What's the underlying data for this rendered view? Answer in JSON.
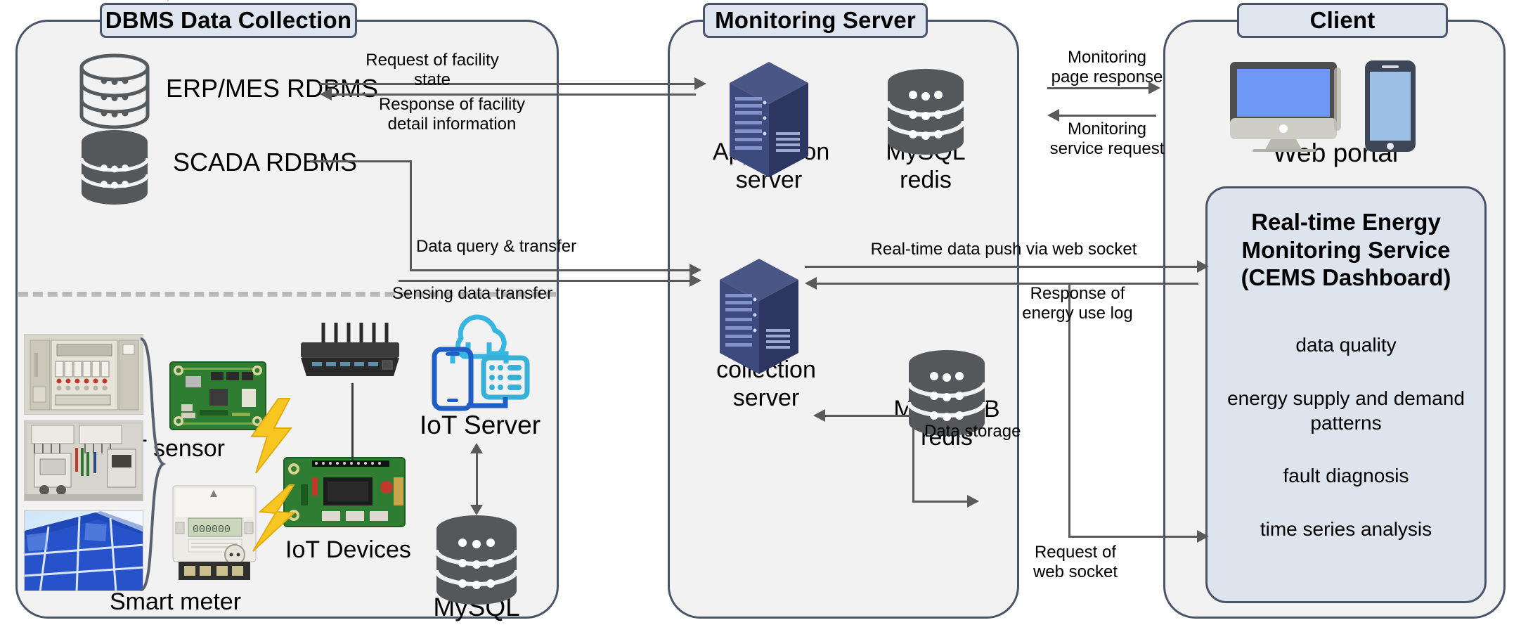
{
  "diagram": {
    "title_bar_color": "#dee5ee",
    "panel_fill": "#f2f2f2",
    "panel_border": "#4a5468",
    "arrow_color": "#5a5a5a",
    "cems_fill": "#dde4ed"
  },
  "panels": [
    {
      "id": "dbms",
      "title": "DBMS Data Collection"
    },
    {
      "id": "monitoring",
      "title": "Monitoring Server"
    },
    {
      "id": "client",
      "title": "Client"
    }
  ],
  "dbms": {
    "nodes": [
      {
        "name": "ERP/MES RDBMS",
        "icon": "database-outline-icon"
      },
      {
        "name": "SCADA RDBMS",
        "icon": "database-filled-icon"
      },
      {
        "name": "IoT sensor",
        "icon": "sensor-board-photo"
      },
      {
        "name": "IoT Devices",
        "icon": "iot-board-photo"
      },
      {
        "name": "Smart meter",
        "icon": "smart-meter-photo"
      },
      {
        "name": "IoT Server",
        "icon": "cloud-iot-icon"
      },
      {
        "name": "MySQL",
        "icon": "database-filled-icon"
      }
    ],
    "photos": [
      {
        "name": "distribution-panel-photo"
      },
      {
        "name": "switchgear-photo"
      },
      {
        "name": "solar-panel-photo"
      }
    ],
    "labels": {
      "erp_mes": "ERP/MES RDBMS",
      "scada": "SCADA RDBMS",
      "iot_sensor": "IoT sensor",
      "iot_devices": "IoT Devices",
      "smart_meter": "Smart meter",
      "iot_server": "IoT Server",
      "mysql": "MySQL"
    }
  },
  "monitoring": {
    "labels": {
      "application_server": "Application\nserver",
      "mysql_redis": "MySQL\nredis",
      "data_collection_server": "Data collection\nserver",
      "mongodb_redis": "MongoDB\nredis"
    },
    "nodes": [
      {
        "name": "Application server",
        "icon": "server-tower-icon"
      },
      {
        "name": "MySQL redis",
        "icon": "database-filled-icon"
      },
      {
        "name": "Data collection server",
        "icon": "server-tower-icon"
      },
      {
        "name": "MongoDB redis",
        "icon": "database-filled-icon"
      }
    ]
  },
  "client": {
    "labels": {
      "web_portal": "Web portal"
    },
    "nodes": [
      {
        "name": "Web portal",
        "icon": "monitor-and-phone-icon"
      }
    ],
    "cems": {
      "title": "Real-time Energy\nMonitoring Service\n(CEMS Dashboard)",
      "items": [
        "data quality",
        "energy supply and demand\npatterns",
        "fault diagnosis",
        "time series analysis"
      ]
    }
  },
  "flows": {
    "request_of_facility_state": "Request of facility\nstate",
    "response_of_facility_detail": "Response of facility\ndetail information",
    "data_query_transfer": "Data query & transfer",
    "sensing_data_transfer": "Sensing data transfer",
    "data_storage": "Data storage",
    "realtime_push": "Real-time data push via web socket",
    "response_energy_log": "Response of\nenergy use log",
    "request_web_socket": "Request of\nweb socket",
    "monitoring_page_response": "Monitoring\npage response",
    "monitoring_service_request": "Monitoring\nservice request"
  }
}
